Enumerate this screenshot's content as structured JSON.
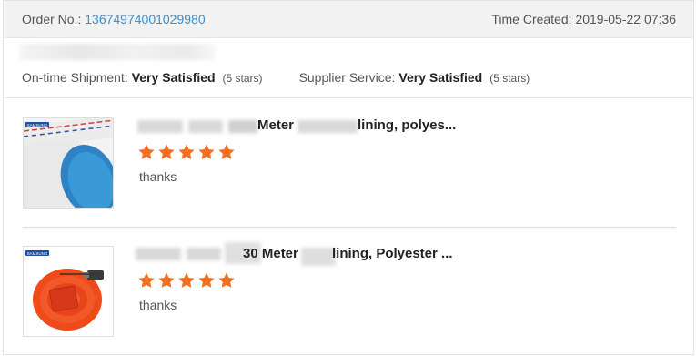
{
  "order": {
    "order_no_label": "Order No.:",
    "order_no_value": "13674974001029980",
    "time_created_label": "Time Created:",
    "time_created_value": "2019-05-22 07:36"
  },
  "ratings": {
    "ontime_label": "On-time Shipment:",
    "ontime_value": "Very Satisfied",
    "ontime_note": "(5 stars)",
    "supplier_label": "Supplier Service:",
    "supplier_value": "Very Satisfied",
    "supplier_note": "(5 stars)"
  },
  "items": [
    {
      "title_part_a": "Meter",
      "title_part_b": "lining, polyes...",
      "rating": 5,
      "feedback": "thanks",
      "thumb_brand": "SAMSUNG"
    },
    {
      "title_part_a": "30 Meter",
      "title_part_b": "lining, Polyester ...",
      "rating": 5,
      "feedback": "thanks",
      "thumb_brand": "SAMSUNG"
    }
  ],
  "colors": {
    "link": "#3a8fd0",
    "star": "#f36f21",
    "header_bg": "#f2f2f2"
  },
  "icons": {
    "star": "star-icon"
  }
}
